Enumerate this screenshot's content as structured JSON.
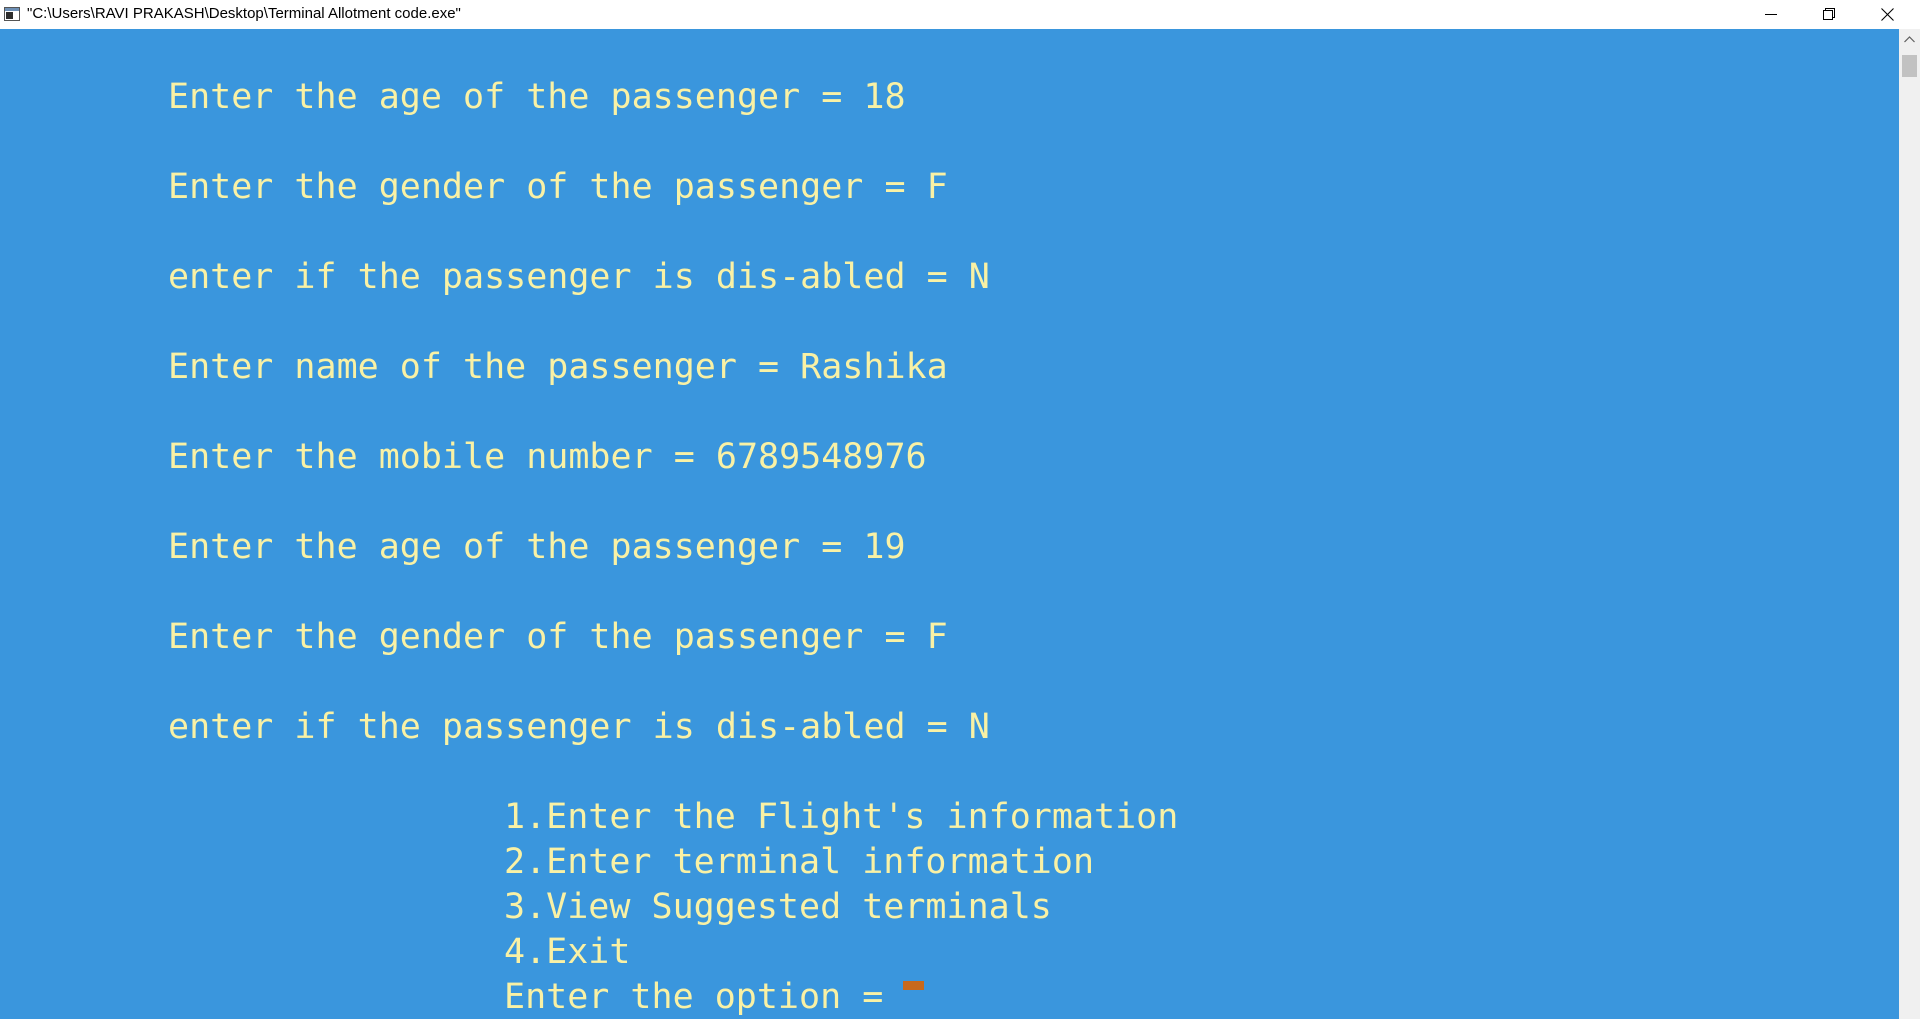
{
  "window": {
    "title": "\"C:\\Users\\RAVI PRAKASH\\Desktop\\Terminal Allotment code.exe\"",
    "icon": "console-app-icon",
    "controls": {
      "minimize_icon": "minimize-icon",
      "maximize_icon": "restore-icon",
      "close_icon": "close-icon"
    }
  },
  "console": {
    "background_color": "#3a96dd",
    "text_color": "#f9f1a5",
    "cursor_color": "#c8691c",
    "prompts": [
      "Enter the age of the passenger = 18",
      "Enter the gender of the passenger = F",
      "enter if the passenger is dis-abled = N",
      "Enter name of the passenger = Rashika",
      "Enter the mobile number = 6789548976",
      "Enter the age of the passenger = 19",
      "Enter the gender of the passenger = F",
      "enter if the passenger is dis-abled = N"
    ],
    "menu": [
      "1.Enter the Flight's information",
      "2.Enter terminal information",
      "3.View Suggested terminals",
      "4.Exit"
    ],
    "input_prompt": "Enter the option = "
  }
}
